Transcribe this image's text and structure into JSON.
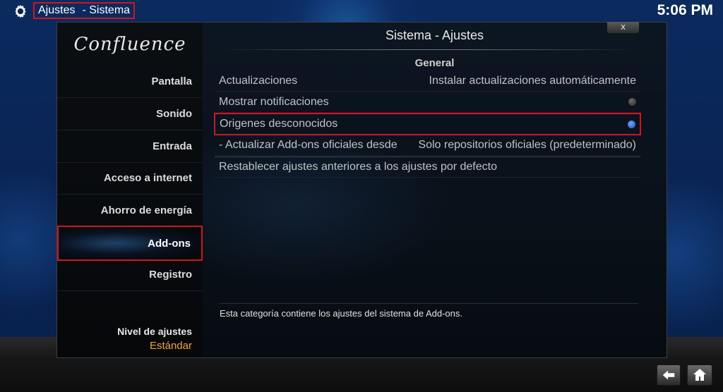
{
  "header": {
    "breadcrumb": [
      "Ajustes",
      "- Sistema"
    ],
    "clock": "5:06 PM"
  },
  "dialog": {
    "logo": "Confluence",
    "title": "Sistema - Ajustes",
    "close_label": "x",
    "section": "General",
    "hint": "Esta categoría contiene los ajustes del sistema de Add-ons."
  },
  "sidebar": {
    "items": [
      {
        "label": "Pantalla"
      },
      {
        "label": "Sonido"
      },
      {
        "label": "Entrada"
      },
      {
        "label": "Acceso a internet"
      },
      {
        "label": "Ahorro de energía"
      },
      {
        "label": "Add-ons"
      },
      {
        "label": "Registro"
      }
    ],
    "level_label": "Nivel de ajustes",
    "level_value": "Estándar"
  },
  "settings": [
    {
      "label": "Actualizaciones",
      "value": "Instalar actualizaciones automáticamente"
    },
    {
      "label": "Mostrar notificaciones",
      "toggle": "off"
    },
    {
      "label": "Origenes desconocidos",
      "toggle": "on"
    },
    {
      "label": "- Actualizar Add-ons oficiales desde",
      "value": "Solo repositorios oficiales (predeterminado)"
    },
    {
      "label": "Restablecer ajustes anteriores a los ajustes por defecto"
    }
  ],
  "icons": {
    "gear": "gear-icon",
    "back": "back-arrow-icon",
    "home": "home-icon"
  },
  "colors": {
    "highlight": "#d0161f",
    "accent_value": "#f0a23a",
    "toggle_on": "#1a4fb8"
  }
}
